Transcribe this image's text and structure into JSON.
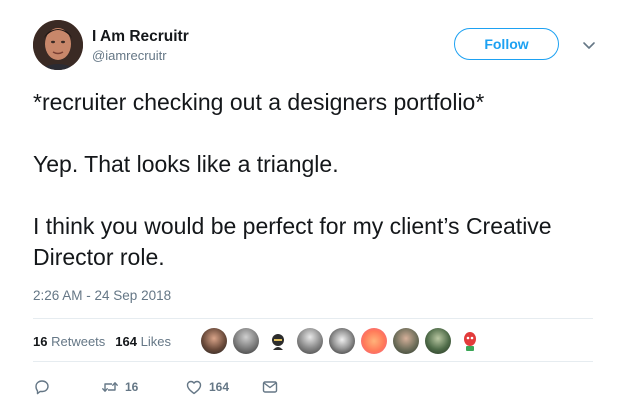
{
  "user": {
    "display_name": "I Am Recruitr",
    "handle": "@iamrecruitr"
  },
  "follow_label": "Follow",
  "tweet": {
    "lines": [
      "*recruiter checking out a designers portfolio*",
      "Yep. That looks like a triangle.",
      "I think you would be perfect for my client’s Creative Director role."
    ],
    "timestamp": "2:26 AM - 24 Sep 2018"
  },
  "stats": {
    "retweets_count": "16",
    "retweets_label": "Retweets",
    "likes_count": "164",
    "likes_label": "Likes"
  },
  "actions": {
    "reply_count": "",
    "retweet_count": "16",
    "like_count": "164"
  },
  "colors": {
    "accent": "#1da1f2",
    "text": "#14171a",
    "muted": "#657786",
    "divider": "#e6ecf0"
  },
  "icons": [
    "reply-icon",
    "retweet-icon",
    "heart-icon",
    "message-icon",
    "chevron-down-icon"
  ]
}
